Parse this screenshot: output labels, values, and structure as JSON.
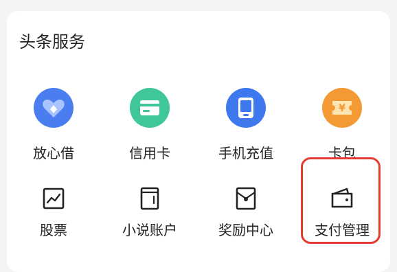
{
  "section": {
    "title": "头条服务"
  },
  "services": [
    {
      "label": "放心借",
      "icon": "heart-diamond-icon",
      "color": "#4a7ef0"
    },
    {
      "label": "信用卡",
      "icon": "credit-card-icon",
      "color": "#3fc79a"
    },
    {
      "label": "手机充值",
      "icon": "phone-icon",
      "color": "#3e78ee"
    },
    {
      "label": "卡包",
      "icon": "yuan-ticket-icon",
      "color": "#f39a34"
    },
    {
      "label": "股票",
      "icon": "stock-chart-icon"
    },
    {
      "label": "小说账户",
      "icon": "book-icon"
    },
    {
      "label": "奖励中心",
      "icon": "red-envelope-icon"
    },
    {
      "label": "支付管理",
      "icon": "wallet-icon"
    }
  ],
  "highlight": {
    "target": "支付管理",
    "color": "#e23c32"
  }
}
